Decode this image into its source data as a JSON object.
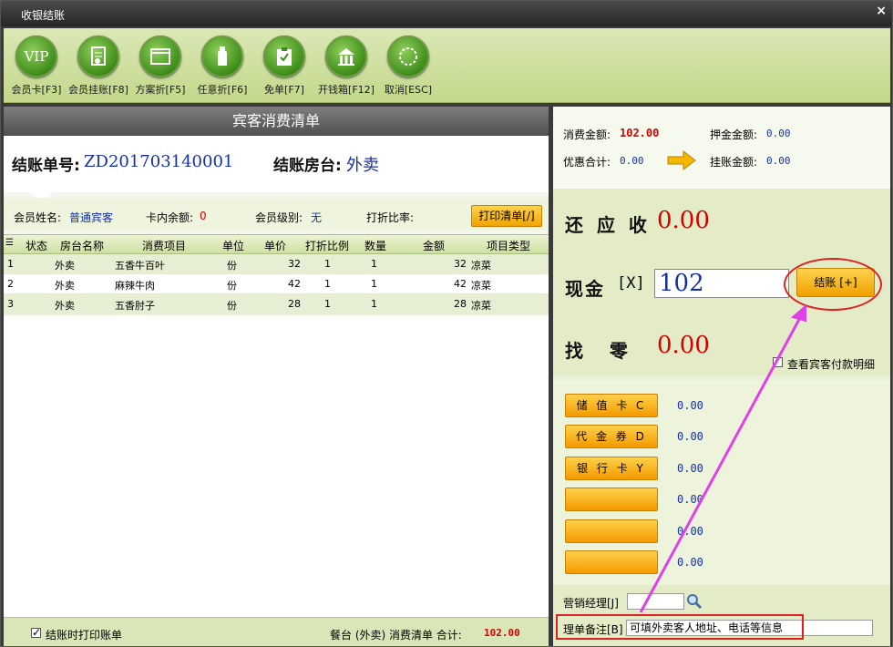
{
  "window": {
    "title": "收银结账",
    "close": "×"
  },
  "toolbar": [
    {
      "name": "member-card-button",
      "icon": "vip",
      "label": "会员卡[F3]"
    },
    {
      "name": "member-charge-button",
      "icon": "document",
      "label": "会员挂账[F8]"
    },
    {
      "name": "plan-discount-button",
      "icon": "window",
      "label": "方案折[F5]"
    },
    {
      "name": "any-discount-button",
      "icon": "bottle",
      "label": "任意折[F6]"
    },
    {
      "name": "free-bill-button",
      "icon": "clipboard-check",
      "label": "免单[F7]"
    },
    {
      "name": "open-cashbox-button",
      "icon": "cashbox",
      "label": "开钱箱[F12]"
    },
    {
      "name": "cancel-button",
      "icon": "ring",
      "label": "取消[ESC]"
    }
  ],
  "bill": {
    "header": "宾客消费清单",
    "no_label": "结账单号:",
    "no_value": "ZD201703140001",
    "table_label": "结账房台:",
    "table_value": "外卖"
  },
  "member": {
    "name_label": "会员姓名:",
    "name_value": "普通宾客",
    "balance_label": "卡内余额:",
    "balance_value": "0",
    "level_label": "会员级别:",
    "level_value": "无",
    "discount_label": "打折比率:",
    "print_button": "打印清单[/]"
  },
  "table": {
    "columns": [
      "状态",
      "房台名称",
      "消费项目",
      "单位",
      "单价",
      "打折比例",
      "数量",
      "金额",
      "项目类型"
    ],
    "rows": [
      {
        "no": "1",
        "status": "",
        "room": "外卖",
        "item": "五香牛百叶",
        "unit": "份",
        "price": "32",
        "discount": "1",
        "qty": "1",
        "amount": "32",
        "type": "凉菜"
      },
      {
        "no": "2",
        "status": "",
        "room": "外卖",
        "item": "麻辣牛肉",
        "unit": "份",
        "price": "42",
        "discount": "1",
        "qty": "1",
        "amount": "42",
        "type": "凉菜"
      },
      {
        "no": "3",
        "status": "",
        "room": "外卖",
        "item": "五香肘子",
        "unit": "份",
        "price": "28",
        "discount": "1",
        "qty": "1",
        "amount": "28",
        "type": "凉菜"
      }
    ]
  },
  "footer": {
    "print_check": "✓",
    "print_label": "结账时打印账单",
    "summary": "餐台 (外卖) 消费清单 合计:",
    "total": "102.00"
  },
  "summary": {
    "consume_label": "消费金额:",
    "consume_value": "102.00",
    "deposit_label": "押金金额:",
    "deposit_value": "0.00",
    "discount_label": "优惠合计:",
    "discount_value": "0.00",
    "charge_label": "挂账金额:",
    "charge_value": "0.00"
  },
  "payment": {
    "due_label": "还 应 收",
    "due_value": "0.00",
    "cash_label": "现金",
    "cash_key": "[X]",
    "cash_value": "102",
    "settle_button": "结账 [+]",
    "change_label": "找   零",
    "change_value": "0.00",
    "detail_check": "✓",
    "detail_label": "查看宾客付款明细"
  },
  "methods": [
    {
      "label": "储 值 卡 C",
      "value": "0.00"
    },
    {
      "label": "代 金 券 D",
      "value": "0.00"
    },
    {
      "label": "银 行 卡 Y",
      "value": "0.00"
    },
    {
      "label": "",
      "value": "0.00"
    },
    {
      "label": "",
      "value": "0.00"
    },
    {
      "label": "",
      "value": "0.00"
    }
  ],
  "bottom": {
    "manager_label": "营销经理[J]",
    "manager_value": "",
    "note_label": "理单备注[B]",
    "note_value": "可填外卖客人地址、电话等信息"
  },
  "colors": {
    "accent_red": "#d40000",
    "value_blue": "#1431a6",
    "annotation_pink": "#e040e8",
    "button_orange": "#f0a500"
  }
}
